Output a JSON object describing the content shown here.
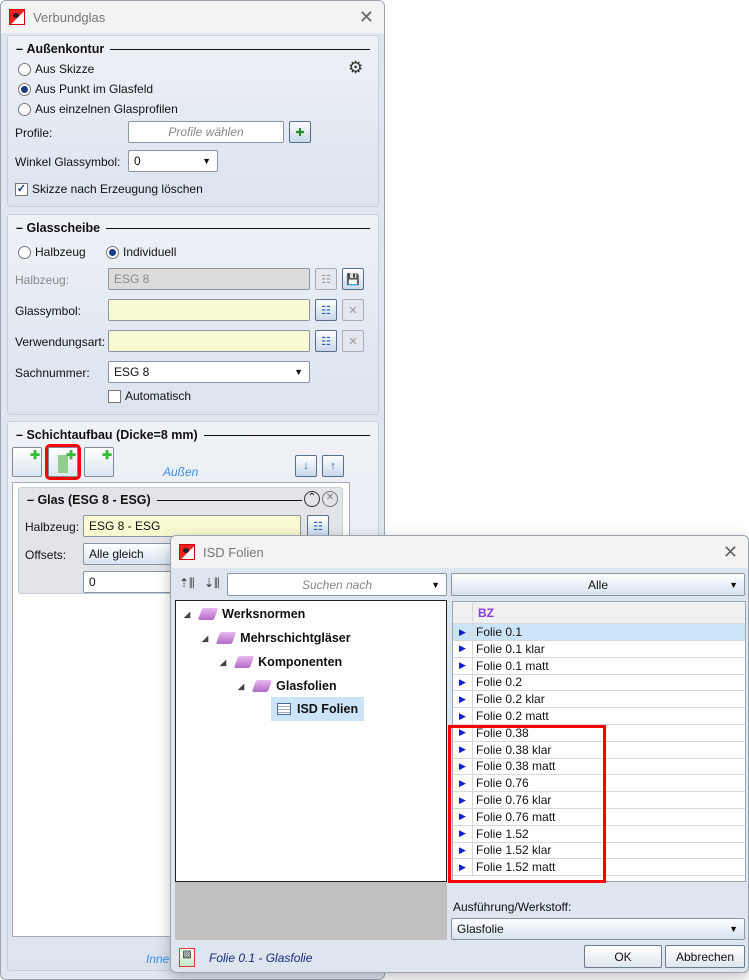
{
  "main": {
    "title": "Verbundglas",
    "aussenkontur": {
      "heading": "Außenkontur",
      "options": [
        "Aus Skizze",
        "Aus Punkt im Glasfeld",
        "Aus einzelnen Glasprofilen"
      ],
      "selected": 1,
      "profile_label": "Profile:",
      "profile_placeholder": "Profile wählen",
      "winkel_label": "Winkel Glassymbol:",
      "winkel_value": "0",
      "skizze_loeschen": "Skizze nach Erzeugung löschen",
      "skizze_checked": true
    },
    "glasscheibe": {
      "heading": "Glasscheibe",
      "options": [
        "Halbzeug",
        "Individuell"
      ],
      "selected": 1,
      "halbzeug_label": "Halbzeug:",
      "halbzeug_value": "ESG 8",
      "glassymbol_label": "Glassymbol:",
      "glassymbol_value": "",
      "verwendungsart_label": "Verwendungsart:",
      "verwendungsart_value": "",
      "sachnummer_label": "Sachnummer:",
      "sachnummer_value": "ESG 8",
      "automatisch": "Automatisch",
      "automatisch_checked": false
    },
    "schichtaufbau": {
      "heading": "Schichtaufbau (Dicke=8 mm)",
      "aussen": "Außen",
      "innen": "Innen",
      "glas": {
        "heading": "Glas (ESG 8 - ESG)",
        "halbzeug_label": "Halbzeug:",
        "halbzeug_value": "ESG 8 - ESG",
        "offsets_label": "Offsets:",
        "offsets_value": "Alle gleich",
        "offset_value": "0"
      }
    }
  },
  "dialog": {
    "title": "ISD Folien",
    "search_placeholder": "Suchen nach",
    "filter_value": "Alle",
    "tree": [
      {
        "label": "Werksnormen",
        "level": 0
      },
      {
        "label": "Mehrschichtgläser",
        "level": 1
      },
      {
        "label": "Komponenten",
        "level": 2
      },
      {
        "label": "Glasfolien",
        "level": 3
      },
      {
        "label": "ISD Folien",
        "level": 4,
        "selected": true
      }
    ],
    "grid": {
      "header": "BZ",
      "rows": [
        "Folie 0.1",
        "Folie 0.1 klar",
        "Folie 0.1 matt",
        "Folie 0.2",
        "Folie 0.2 klar",
        "Folie 0.2 matt",
        "Folie 0.38",
        "Folie 0.38 klar",
        "Folie 0.38 matt",
        "Folie 0.76",
        "Folie 0.76 klar",
        "Folie 0.76 matt",
        "Folie 1.52",
        "Folie 1.52 klar",
        "Folie 1.52 matt"
      ],
      "selected": 0
    },
    "ausfuehrung_label": "Ausführung/Werkstoff:",
    "ausfuehrung_value": "Glasfolie",
    "status": "Folie 0.1 - Glasfolie",
    "ok": "OK",
    "cancel": "Abbrechen"
  },
  "colors": {
    "highlight": "#ff0000",
    "accent_link": "#3a8ee6",
    "selection": "#cce4f7",
    "header_text": "#8a3adc"
  }
}
